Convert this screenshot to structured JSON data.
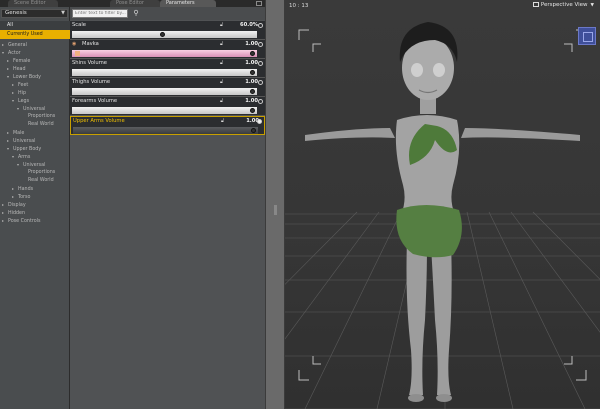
{
  "tabs": {
    "left_partial_1": "Scene Editor",
    "left_partial_2": "Pose Editor",
    "active": "Parameters"
  },
  "tree": {
    "figure_select": "Genesis",
    "all_label": "All",
    "current_label": "Currently Used",
    "items": [
      {
        "label": "General",
        "arrow": "▸",
        "indent": 1
      },
      {
        "label": "Actor",
        "arrow": "▾",
        "indent": 1
      },
      {
        "label": "Female",
        "arrow": "▸",
        "indent": 2
      },
      {
        "label": "Head",
        "arrow": "▸",
        "indent": 2
      },
      {
        "label": "Lower Body",
        "arrow": "▾",
        "indent": 2
      },
      {
        "label": "Feet",
        "arrow": "▸",
        "indent": 3
      },
      {
        "label": "Hip",
        "arrow": "▸",
        "indent": 3
      },
      {
        "label": "Legs",
        "arrow": "▾",
        "indent": 3
      },
      {
        "label": "Universal",
        "arrow": "▾",
        "indent": 4
      },
      {
        "label": "Proportions",
        "arrow": "",
        "indent": 5
      },
      {
        "label": "Real World",
        "arrow": "",
        "indent": 5
      },
      {
        "label": "Male",
        "arrow": "▸",
        "indent": 2
      },
      {
        "label": "Universal",
        "arrow": "▸",
        "indent": 2
      },
      {
        "label": "Upper Body",
        "arrow": "▾",
        "indent": 2
      },
      {
        "label": "Arms",
        "arrow": "▾",
        "indent": 3
      },
      {
        "label": "Universal",
        "arrow": "▾",
        "indent": 4
      },
      {
        "label": "Proportions",
        "arrow": "",
        "indent": 5
      },
      {
        "label": "Real World",
        "arrow": "",
        "indent": 5
      },
      {
        "label": "Hands",
        "arrow": "▸",
        "indent": 3
      },
      {
        "label": "Torso",
        "arrow": "▸",
        "indent": 3
      },
      {
        "label": "Display",
        "arrow": "▸",
        "indent": 1
      },
      {
        "label": "Hidden",
        "arrow": "▸",
        "indent": 1
      },
      {
        "label": "Pose Controls",
        "arrow": "▸",
        "indent": 1
      }
    ]
  },
  "filter": {
    "placeholder": "Enter text to filter by..."
  },
  "properties": [
    {
      "label": "Scale",
      "value": "60.0%",
      "style": "light",
      "level": 0.5,
      "has_icon": false,
      "highlight": false
    },
    {
      "label": "Mavka",
      "value": "1.00",
      "style": "pink",
      "level": 1.0,
      "has_icon": true,
      "highlight": false
    },
    {
      "label": "Shins Volume",
      "value": "1.00",
      "style": "light",
      "level": 1.0,
      "has_icon": false,
      "highlight": false
    },
    {
      "label": "Thighs Volume",
      "value": "1.00",
      "style": "light",
      "level": 1.0,
      "has_icon": false,
      "highlight": false
    },
    {
      "label": "Forearms Volume",
      "value": "1.00",
      "style": "light",
      "level": 1.0,
      "has_icon": false,
      "highlight": false
    },
    {
      "label": "Upper Arms Volume",
      "value": "1.00",
      "style": "dark",
      "level": 1.0,
      "has_icon": false,
      "highlight": true
    }
  ],
  "viewport": {
    "coords": "10 : 13",
    "view_label": "Perspective View"
  },
  "colors": {
    "accent": "#e8b000",
    "tree_bg": "#4a4d4f",
    "panel_bg": "#505254",
    "viewport_bg": "#3a3a3a",
    "cube": "#3f4f9a"
  }
}
